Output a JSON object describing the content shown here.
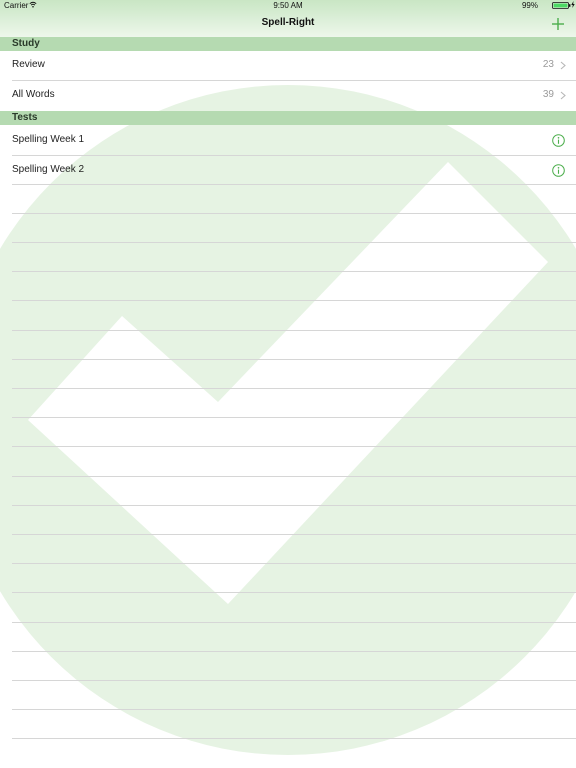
{
  "status_bar": {
    "carrier": "Carrier",
    "time": "9:50 AM",
    "battery": "99%"
  },
  "nav": {
    "title": "Spell-Right",
    "add_icon": "plus-icon"
  },
  "sections": [
    {
      "title": "Study",
      "rows": [
        {
          "label": "Review",
          "count": "23",
          "accessory": "chevron-right-icon"
        },
        {
          "label": "All Words",
          "count": "39",
          "accessory": "chevron-right-icon"
        }
      ]
    },
    {
      "title": "Tests",
      "rows": [
        {
          "label": "Spelling Week 1",
          "accessory": "info-icon"
        },
        {
          "label": "Spelling Week 2",
          "accessory": "info-icon"
        }
      ]
    }
  ],
  "colors": {
    "accent": "#4cae4c",
    "section_header": "#b5dab1",
    "watermark": "#e3f1e0"
  }
}
